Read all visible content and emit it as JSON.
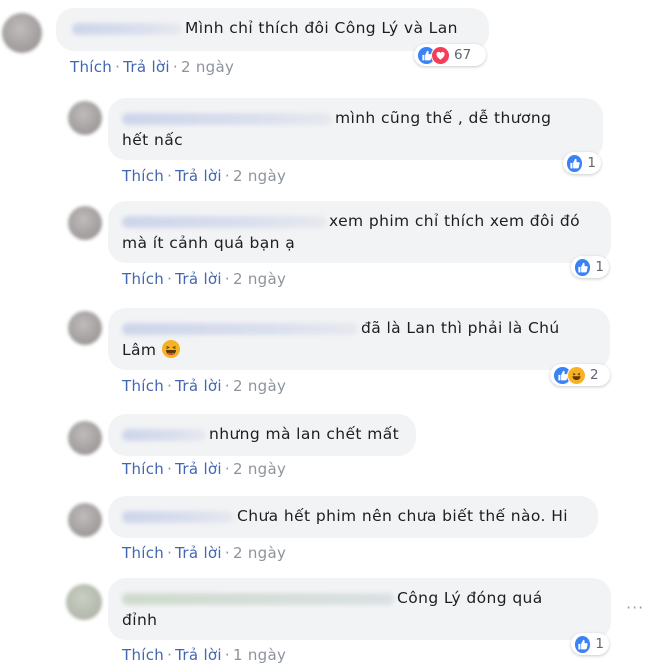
{
  "comments": [
    {
      "text_lines": [
        "Mình chỉ thích đôi Công Lý và Lan"
      ],
      "like_label": "Thích",
      "reply_label": "Trả lời",
      "time": "2 ngày",
      "reactions": [
        "like-icon",
        "love-icon"
      ],
      "reaction_count": "67"
    },
    {
      "text_lines": [
        "mình cũng thế , dễ thương",
        "hết nấc"
      ],
      "like_label": "Thích",
      "reply_label": "Trả lời",
      "time": "2 ngày",
      "reactions": [
        "like-icon"
      ],
      "reaction_count": "1"
    },
    {
      "text_lines": [
        "xem phim chỉ thích xem đôi đó",
        "mà ít cảnh quá bạn ạ"
      ],
      "like_label": "Thích",
      "reply_label": "Trả lời",
      "time": "2 ngày",
      "reactions": [
        "like-icon"
      ],
      "reaction_count": "1"
    },
    {
      "text_lines": [
        "đã là Lan thì phải là Chú",
        "Lâm"
      ],
      "like_label": "Thích",
      "reply_label": "Trả lời",
      "time": "2 ngày",
      "reactions": [
        "like-icon",
        "haha-icon"
      ],
      "reaction_count": "2"
    },
    {
      "text_lines": [
        "nhưng mà lan chết mất"
      ],
      "like_label": "Thích",
      "reply_label": "Trả lời",
      "time": "2 ngày",
      "reactions": [],
      "reaction_count": ""
    },
    {
      "text_lines": [
        "Chưa hết phim nên chưa biết thế nào. Hi"
      ],
      "like_label": "Thích",
      "reply_label": "Trả lời",
      "time": "2 ngày",
      "reactions": [],
      "reaction_count": ""
    },
    {
      "text_lines": [
        "Công Lý đóng quá",
        "đỉnh"
      ],
      "like_label": "Thích",
      "reply_label": "Trả lời",
      "time": "1 ngày",
      "reactions": [
        "like-icon"
      ],
      "reaction_count": "1"
    }
  ],
  "colors": {
    "bubble": "#f2f3f5",
    "link": "#4267b2",
    "meta": "#8d949e",
    "like": "#3b82f6",
    "love": "#f33e58",
    "haha": "#f7b125"
  },
  "more_icon": "more-options-icon"
}
